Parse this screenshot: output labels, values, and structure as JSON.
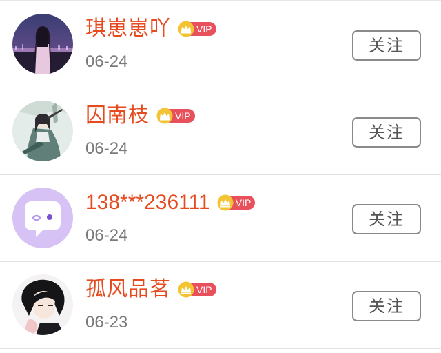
{
  "colors": {
    "name": "#e64a1f",
    "date": "#7a7a7a",
    "vip_pill": "#e8505b",
    "vip_crown": "#f2c433",
    "button_border": "#8a8a8a"
  },
  "vip_label": "VIP",
  "follow_label": "关注",
  "users": [
    {
      "name": "琪崽崽吖",
      "date": "06-24",
      "avatar": "night-city-girl-avatar"
    },
    {
      "name": "囚南枝",
      "date": "06-24",
      "avatar": "ink-swordsman-avatar"
    },
    {
      "name": "138***236111",
      "date": "06-24",
      "avatar": "chat-bubble-avatar"
    },
    {
      "name": "孤风品茗",
      "date": "06-23",
      "avatar": "anime-boy-avatar"
    }
  ]
}
